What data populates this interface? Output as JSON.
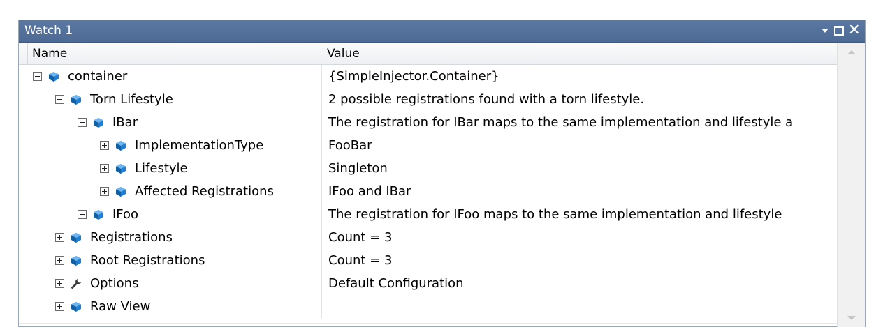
{
  "window": {
    "title": "Watch 1"
  },
  "columns": {
    "name": "Name",
    "value": "Value"
  },
  "colors": {
    "titlebar": "#4d6a95",
    "object_icon": "#1e7fd4",
    "wrench_icon": "#3a3a3a"
  },
  "rows": [
    {
      "name": "container",
      "value": "{SimpleInjector.Container}",
      "level": 0,
      "expanded": true,
      "icon": "object-icon"
    },
    {
      "name": "Torn Lifestyle",
      "value": "2 possible registrations found with a torn lifestyle.",
      "level": 1,
      "expanded": true,
      "icon": "object-icon"
    },
    {
      "name": "IBar",
      "value": "The registration for IBar maps to the same implementation and lifestyle a",
      "level": 2,
      "expanded": true,
      "icon": "object-icon"
    },
    {
      "name": "ImplementationType",
      "value": "FooBar",
      "level": 3,
      "expanded": false,
      "icon": "object-icon"
    },
    {
      "name": "Lifestyle",
      "value": "Singleton",
      "level": 3,
      "expanded": false,
      "icon": "object-icon"
    },
    {
      "name": "Affected Registrations",
      "value": "IFoo and IBar",
      "level": 3,
      "expanded": false,
      "icon": "object-icon"
    },
    {
      "name": "IFoo",
      "value": "The registration for IFoo maps to the same implementation and lifestyle",
      "level": 2,
      "expanded": false,
      "icon": "object-icon"
    },
    {
      "name": "Registrations",
      "value": "Count = 3",
      "level": 1,
      "expanded": false,
      "icon": "object-icon"
    },
    {
      "name": "Root Registrations",
      "value": "Count = 3",
      "level": 1,
      "expanded": false,
      "icon": "object-icon"
    },
    {
      "name": "Options",
      "value": "Default Configuration",
      "level": 1,
      "expanded": false,
      "icon": "wrench-icon"
    },
    {
      "name": "Raw View",
      "value": "",
      "level": 1,
      "expanded": false,
      "icon": "object-icon"
    }
  ]
}
